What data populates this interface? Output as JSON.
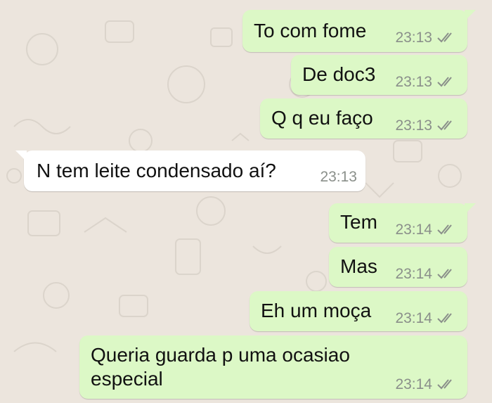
{
  "messages": [
    {
      "text": "To com fome",
      "time": "23:13",
      "status_icon": "double-check-icon"
    },
    {
      "text": "De doc3",
      "time": "23:13",
      "status_icon": "double-check-icon"
    },
    {
      "text": "Q q eu faço",
      "time": "23:13",
      "status_icon": "double-check-icon"
    },
    {
      "text": "N tem leite condensado aí?",
      "time": "23:13"
    },
    {
      "text": "Tem",
      "time": "23:14",
      "status_icon": "double-check-icon"
    },
    {
      "text": "Mas",
      "time": "23:14",
      "status_icon": "double-check-icon"
    },
    {
      "text": "Eh um moça",
      "time": "23:14",
      "status_icon": "double-check-icon"
    },
    {
      "text_lines": [
        "Queria guarda p uma ocasiao",
        "especial"
      ],
      "time": "23:14",
      "status_icon": "double-check-icon"
    }
  ],
  "colors": {
    "outgoing_bubble": "#DCF8C6",
    "incoming_bubble": "#FFFFFF",
    "background": "#ECE5DD",
    "timestamp": "#8a8f8a"
  }
}
